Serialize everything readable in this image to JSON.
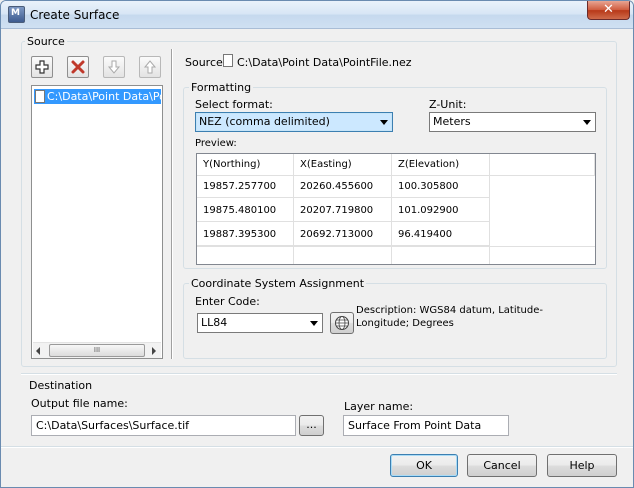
{
  "window": {
    "title": "Create Surface",
    "close_label": "✕"
  },
  "source": {
    "group_label": "Source",
    "path_label": "Source:",
    "path_value": "C:\\Data\\Point Data\\PointFile.nez",
    "list_items": [
      "C:\\Data\\Point Data\\PointFile.nez"
    ],
    "scroll_thumb_label": "III"
  },
  "formatting": {
    "group_label": "Formatting",
    "select_format_label": "Select format:",
    "select_format_value": "NEZ (comma delimited)",
    "z_unit_label": "Z-Unit:",
    "z_unit_value": "Meters",
    "preview_label": "Preview:",
    "columns": [
      "Y(Northing)",
      "X(Easting)",
      "Z(Elevation)"
    ],
    "rows": [
      [
        "19857.257700",
        "20260.455600",
        "100.305800"
      ],
      [
        "19875.480100",
        "20207.719800",
        "101.092900"
      ],
      [
        "19887.395300",
        "20692.713000",
        "96.419400"
      ]
    ]
  },
  "coordinate": {
    "group_label": "Coordinate System Assignment",
    "enter_code_label": "Enter Code:",
    "code_value": "LL84",
    "description": "Description: WGS84 datum, Latitude-Longitude; Degrees"
  },
  "destination": {
    "group_label": "Destination",
    "output_label": "Output file name:",
    "output_value": "C:\\Data\\Surfaces\\Surface.tif",
    "browse_label": "...",
    "layer_label": "Layer name:",
    "layer_value": "Surface From Point Data"
  },
  "buttons": {
    "ok": "OK",
    "cancel": "Cancel",
    "help": "Help"
  },
  "colors": {
    "selection": "#3399ff",
    "delete_icon": "#c0392b"
  }
}
